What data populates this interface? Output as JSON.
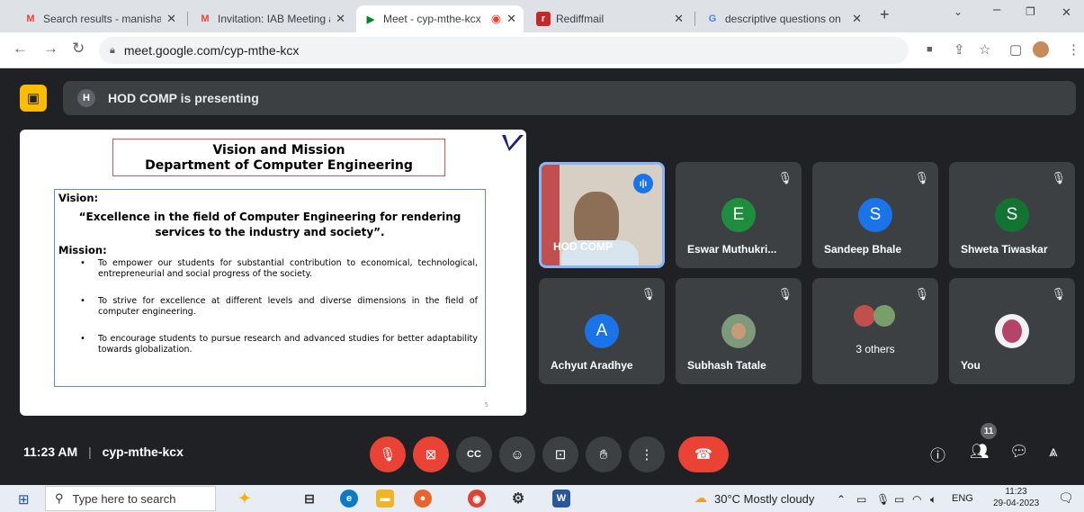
{
  "browser": {
    "tabs": [
      {
        "title": "Search results - manisha.r",
        "icon": "gmail-icon",
        "active": false
      },
      {
        "title": "Invitation: IAB Meeting at",
        "icon": "gmail-icon",
        "active": false
      },
      {
        "title": "Meet - cyp-mthe-kcx",
        "icon": "meet-icon",
        "active": true
      },
      {
        "title": "Rediffmail",
        "icon": "rediff-icon",
        "active": false
      },
      {
        "title": "descriptive questions on",
        "icon": "google-icon",
        "active": false
      }
    ],
    "new_tab": "+",
    "url": "meet.google.com/cyp-mthe-kcx"
  },
  "meet": {
    "presenting_initial": "H",
    "presenting_text": "HOD COMP is presenting",
    "slide": {
      "title_line1": "Vision and Mission",
      "title_line2": "Department of Computer Engineering",
      "vision_heading": "Vision:",
      "vision_text": "“Excellence in the field of Computer Engineering for rendering services to the industry and society”.",
      "mission_heading": "Mission:",
      "mission_items": [
        "To empower our students for substantial contribution to economical, technological, entrepreneurial and social progress of the society.",
        "To strive for excellence at different levels and diverse dimensions in the field of computer engineering.",
        "To encourage students to pursue research and advanced studies for better adaptability towards globalization."
      ],
      "page_number": "5"
    },
    "participants": [
      {
        "name": "HOD COMP",
        "type": "video",
        "speaking": true,
        "muted": false
      },
      {
        "name": "Eswar Muthukri...",
        "initial": "E",
        "color": "#1e8e3e",
        "muted": true
      },
      {
        "name": "Sandeep Bhale",
        "initial": "S",
        "color": "#1a73e8",
        "muted": true
      },
      {
        "name": "Shweta Tiwaskar",
        "initial": "S",
        "color": "#137333",
        "muted": true
      },
      {
        "name": "Achyut Aradhye",
        "initial": "A",
        "color": "#1a73e8",
        "muted": true
      },
      {
        "name": "Subhash Tatale",
        "type": "photo",
        "muted": true
      },
      {
        "name": "3 others",
        "type": "group",
        "muted": true
      },
      {
        "name": "You",
        "type": "photo",
        "muted": true
      }
    ],
    "time": "11:23 AM",
    "meeting_code": "cyp-mthe-kcx",
    "participant_count": "11"
  },
  "taskbar": {
    "search_placeholder": "Type here to search",
    "weather": "30°C  Mostly cloudy",
    "language": "ENG",
    "time": "11:23",
    "date": "29-04-2023"
  }
}
